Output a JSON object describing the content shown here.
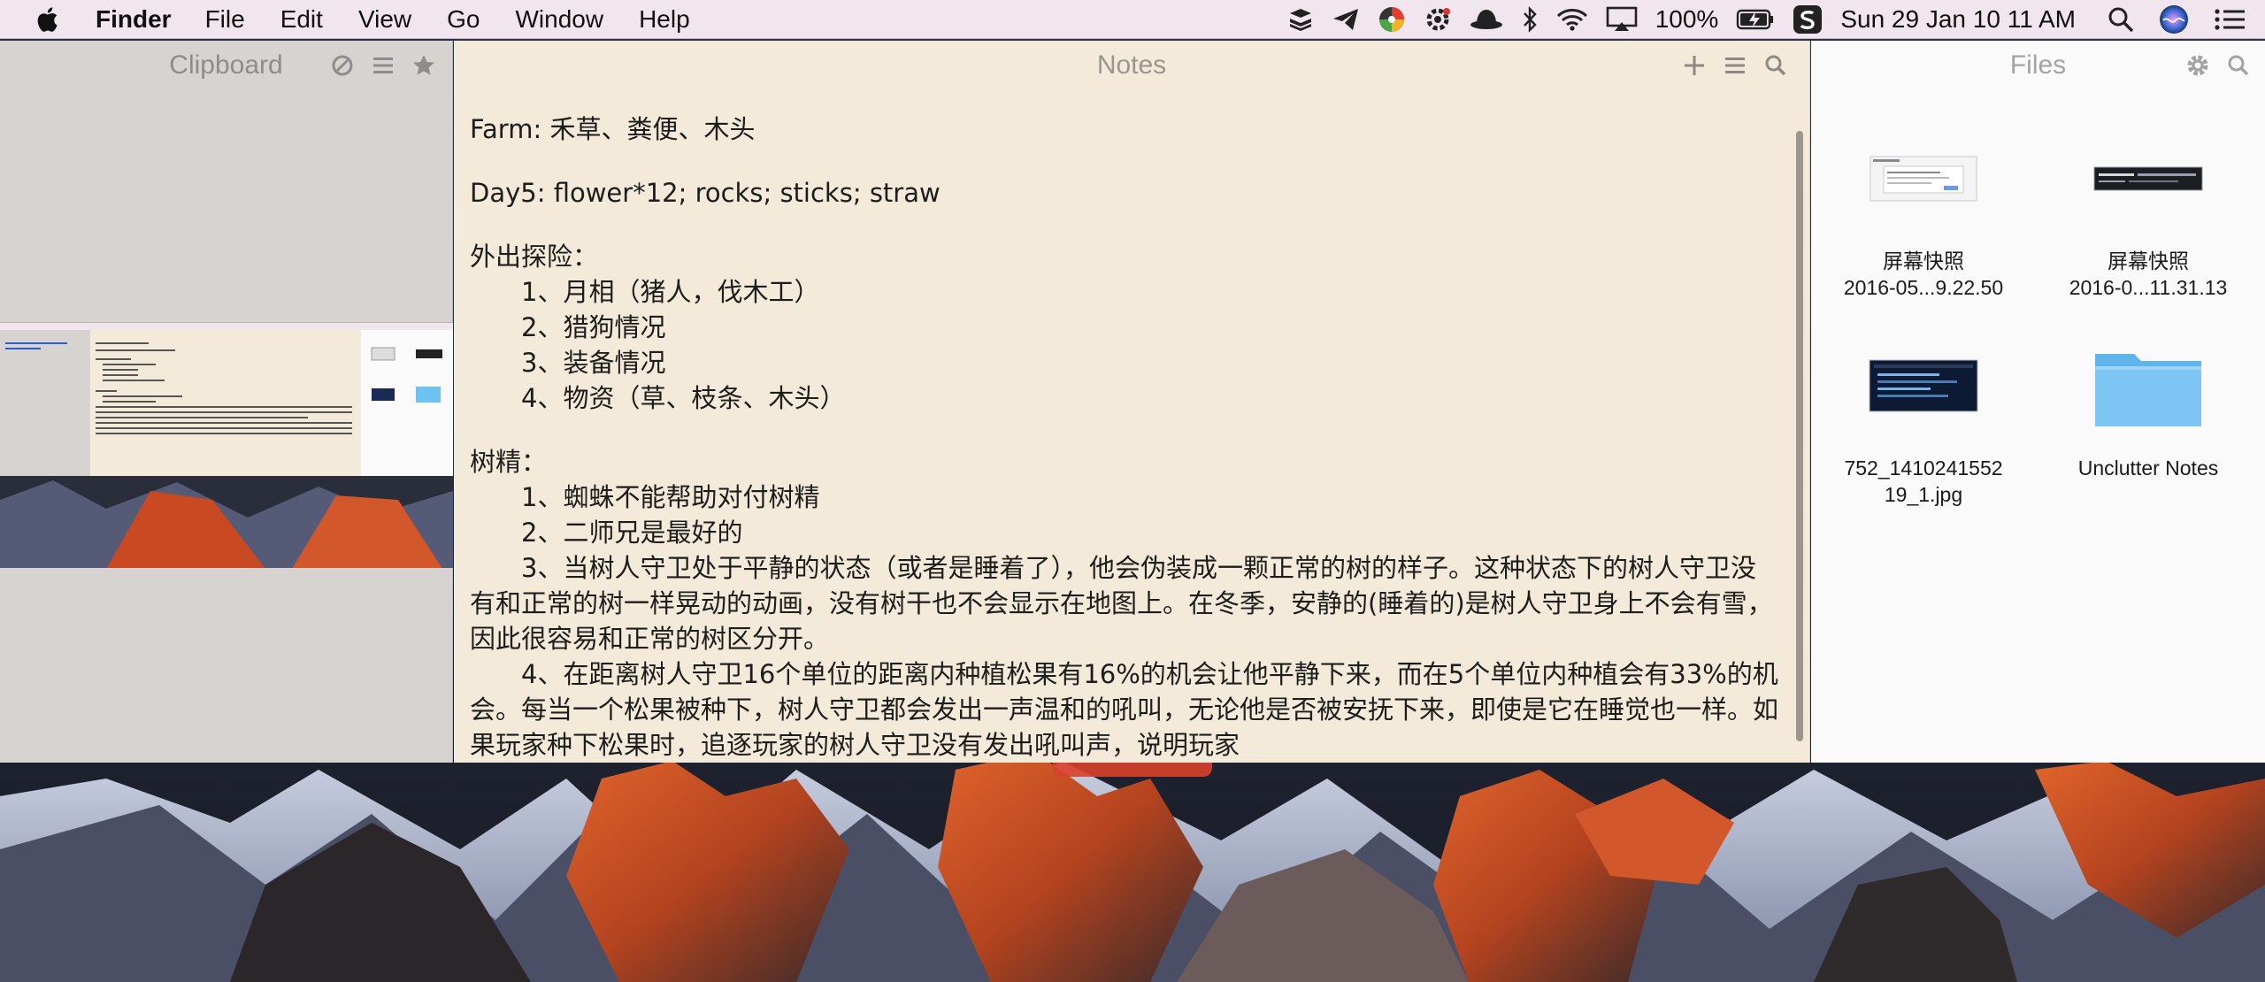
{
  "menubar": {
    "app_name": "Finder",
    "menus": [
      "File",
      "Edit",
      "View",
      "Go",
      "Window",
      "Help"
    ],
    "battery_percent": "100%",
    "datetime": "Sun 29 Jan  10 11 AM",
    "status_icons": [
      "stack-icon",
      "paper-plane-icon",
      "pinwheel-icon",
      "gear-badge-icon",
      "hat-icon",
      "bluetooth-icon",
      "wifi-icon",
      "airplay-icon",
      "battery-charging-icon",
      "s-app-icon",
      "spotlight-icon",
      "siri-icon",
      "notification-center-icon"
    ]
  },
  "clipboard": {
    "title": "Clipboard",
    "header_icons": [
      "clear-icon",
      "list-icon",
      "star-icon"
    ]
  },
  "notes": {
    "title": "Notes",
    "header_icons": [
      "add-icon",
      "list-icon",
      "search-icon"
    ],
    "lines": {
      "l1": "Farm: 禾草、粪便、木头",
      "l2": "Day5: flower*12; rocks; sticks; straw",
      "l3": "外出探险：",
      "l4": "1、月相（猪人，伐木工）",
      "l5": "2、猎狗情况",
      "l6": "3、装备情况",
      "l7": "4、物资（草、枝条、木头）",
      "l8": "树精：",
      "l9": "1、蜘蛛不能帮助对付树精",
      "l10": "2、二师兄是最好的",
      "l11": "3、当树人守卫处于平静的状态（或者是睡着了），他会伪装成一颗正常的树的样子。这种状态下的树人守卫没有和正常的树一样晃动的动画，没有树干也不会显示在地图上。在冬季，安静的(睡着的)是树人守卫身上不会有雪，因此很容易和正常的树区分开。",
      "l12": "4、在距离树人守卫16个单位的距离内种植松果有16%的机会让他平静下来，而在5个单位内种植会有33%的机会。每当一个松果被种下，树人守卫都会发出一声温和的吼叫，无论他是否被安抚下来，即使是它在睡觉也一样。如果玩家种下松果时，追逐玩家的树人守卫没有发出吼叫声，说明玩家"
    }
  },
  "files": {
    "title": "Files",
    "header_icons": [
      "settings-icon",
      "search-icon"
    ],
    "items": [
      {
        "name_line1": "屏幕快照",
        "name_line2": "2016-05...9.22.50"
      },
      {
        "name_line1": "屏幕快照",
        "name_line2": "2016-0...11.31.13"
      },
      {
        "name_line1": "752_1410241552",
        "name_line2": "19_1.jpg"
      },
      {
        "name_line1": "Unclutter Notes",
        "name_line2": ""
      }
    ]
  }
}
